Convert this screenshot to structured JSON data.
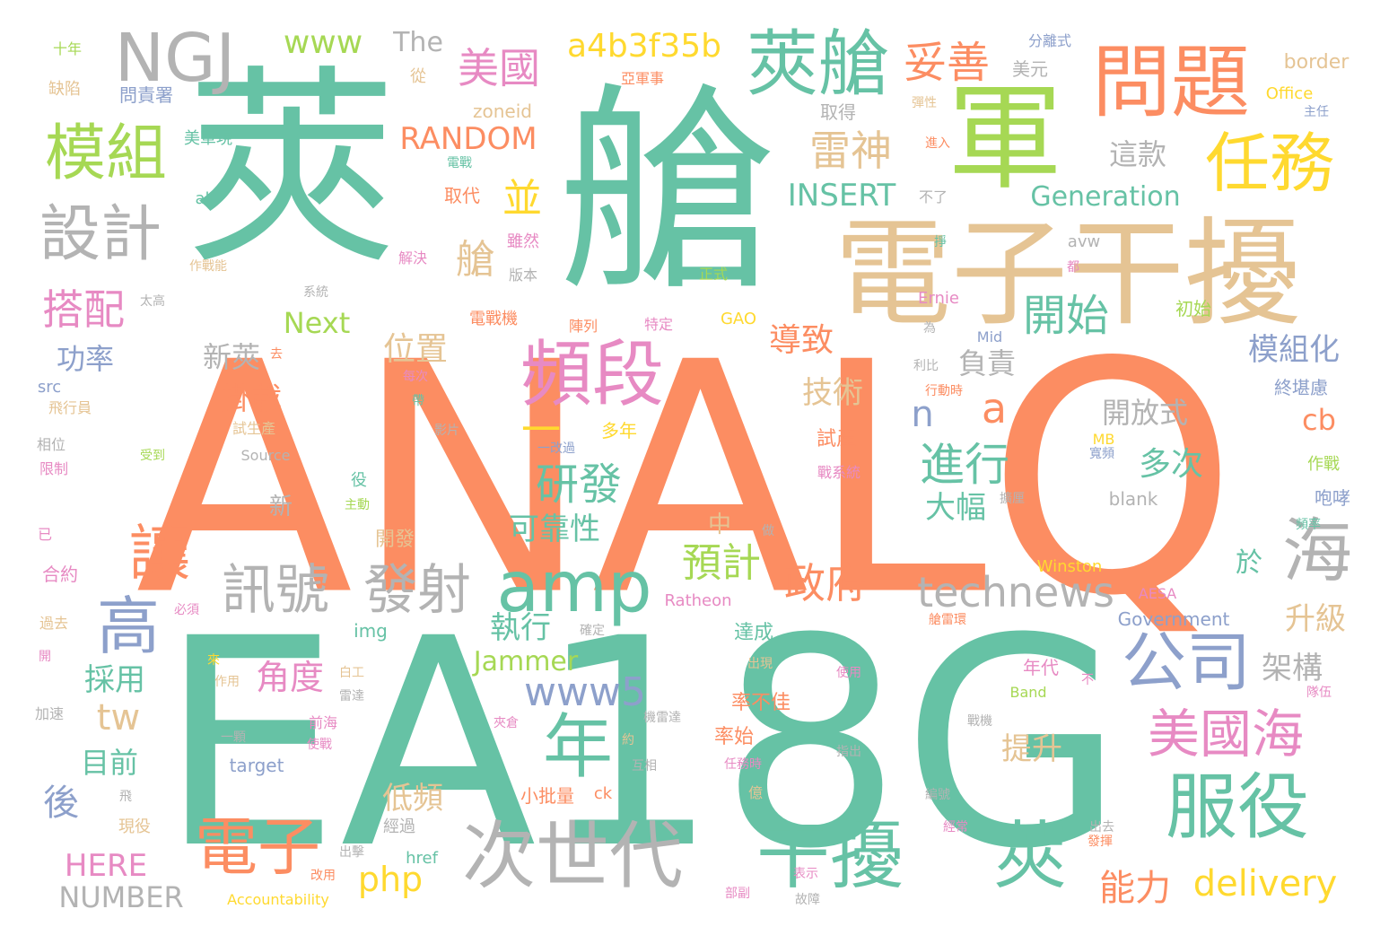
{
  "palette": [
    "#66c2a5",
    "#fc8d62",
    "#8da0cb",
    "#e78ac3",
    "#a6d854",
    "#ffd92f",
    "#e5c494",
    "#b3b3b3"
  ],
  "words": [
    {
      "text": "ANALQ",
      "color": "#fc8d62"
    },
    {
      "text": "EA18G",
      "color": "#66c2a5"
    },
    {
      "text": "莢",
      "color": "#66c2a5"
    },
    {
      "text": "艙",
      "color": "#66c2a5"
    },
    {
      "text": "電子干擾",
      "color": "#e5c494"
    },
    {
      "text": "軍",
      "color": "#a6d854"
    },
    {
      "text": "莢艙",
      "color": "#66c2a5"
    },
    {
      "text": "問題",
      "color": "#fc8d62"
    },
    {
      "text": "任務",
      "color": "#ffd92f"
    },
    {
      "text": "NGJ",
      "color": "#b3b3b3"
    },
    {
      "text": "模組",
      "color": "#a6d854"
    },
    {
      "text": "設計",
      "color": "#b3b3b3"
    },
    {
      "text": "頻段",
      "color": "#e78ac3"
    },
    {
      "text": "amp",
      "color": "#66c2a5"
    },
    {
      "text": "訊號",
      "color": "#b3b3b3"
    },
    {
      "text": "發射",
      "color": "#b3b3b3"
    },
    {
      "text": "高",
      "color": "#8da0cb"
    },
    {
      "text": "讓",
      "color": "#fc8d62"
    },
    {
      "text": "年",
      "color": "#66c2a5"
    },
    {
      "text": "公司",
      "color": "#8da0cb"
    },
    {
      "text": "海",
      "color": "#b3b3b3"
    },
    {
      "text": "服役",
      "color": "#66c2a5"
    },
    {
      "text": "美國海",
      "color": "#e78ac3"
    },
    {
      "text": "次世代",
      "color": "#b3b3b3"
    },
    {
      "text": "干擾",
      "color": "#66c2a5"
    },
    {
      "text": "莢",
      "color": "#66c2a5"
    },
    {
      "text": "電子",
      "color": "#fc8d62"
    },
    {
      "text": "technews",
      "color": "#b3b3b3"
    },
    {
      "text": "www5",
      "color": "#8da0cb"
    },
    {
      "text": "研發",
      "color": "#66c2a5"
    },
    {
      "text": "進行",
      "color": "#66c2a5"
    },
    {
      "text": "開始",
      "color": "#66c2a5"
    },
    {
      "text": "雷神",
      "color": "#e5c494"
    },
    {
      "text": "妥善",
      "color": "#fc8d62"
    },
    {
      "text": "美國",
      "color": "#e78ac3"
    },
    {
      "text": "a4b3f35b",
      "color": "#ffd92f"
    },
    {
      "text": "www",
      "color": "#a6d854"
    },
    {
      "text": "The",
      "color": "#b3b3b3"
    },
    {
      "text": "RANDOM",
      "color": "#fc8d62"
    },
    {
      "text": "INSERT",
      "color": "#66c2a5"
    },
    {
      "text": "Generation",
      "color": "#66c2a5"
    },
    {
      "text": "並",
      "color": "#ffd92f"
    },
    {
      "text": "艙",
      "color": "#e5c494"
    },
    {
      "text": "搭配",
      "color": "#e78ac3"
    },
    {
      "text": "Next",
      "color": "#a6d854"
    },
    {
      "text": "功率",
      "color": "#8da0cb"
    },
    {
      "text": "新莢",
      "color": "#b3b3b3"
    },
    {
      "text": "位置",
      "color": "#e5c494"
    },
    {
      "text": "導致",
      "color": "#fc8d62"
    },
    {
      "text": "負責",
      "color": "#b3b3b3"
    },
    {
      "text": "模組化",
      "color": "#8da0cb"
    },
    {
      "text": "技術",
      "color": "#e5c494"
    },
    {
      "text": "開放式",
      "color": "#b3b3b3"
    },
    {
      "text": "掛載",
      "color": "#fc8d62"
    },
    {
      "text": "一",
      "color": "#ffd92f"
    },
    {
      "text": "n",
      "color": "#8da0cb"
    },
    {
      "text": "a",
      "color": "#fc8d62"
    },
    {
      "text": "cb",
      "color": "#fc8d62"
    },
    {
      "text": "多次",
      "color": "#66c2a5"
    },
    {
      "text": "大幅",
      "color": "#66c2a5"
    },
    {
      "text": "可靠性",
      "color": "#66c2a5"
    },
    {
      "text": "預計",
      "color": "#a6d854"
    },
    {
      "text": "政府",
      "color": "#fc8d62"
    },
    {
      "text": "於",
      "color": "#66c2a5"
    },
    {
      "text": "升級",
      "color": "#e5c494"
    },
    {
      "text": "架構",
      "color": "#b3b3b3"
    },
    {
      "text": "執行",
      "color": "#66c2a5"
    },
    {
      "text": "角度",
      "color": "#e78ac3"
    },
    {
      "text": "採用",
      "color": "#66c2a5"
    },
    {
      "text": "tw",
      "color": "#e5c494"
    },
    {
      "text": "目前",
      "color": "#66c2a5"
    },
    {
      "text": "後",
      "color": "#8da0cb"
    },
    {
      "text": "低頻",
      "color": "#e5c494"
    },
    {
      "text": "Jammer",
      "color": "#a6d854"
    },
    {
      "text": "提升",
      "color": "#e5c494"
    },
    {
      "text": "delivery",
      "color": "#ffd92f"
    },
    {
      "text": "能力",
      "color": "#fc8d62"
    },
    {
      "text": "php",
      "color": "#ffd92f"
    },
    {
      "text": "HERE",
      "color": "#e78ac3"
    },
    {
      "text": "NUMBER",
      "color": "#b3b3b3"
    },
    {
      "text": "這款",
      "color": "#b3b3b3"
    },
    {
      "text": "美元",
      "color": "#b3b3b3"
    },
    {
      "text": "取得",
      "color": "#b3b3b3"
    },
    {
      "text": "zoneid",
      "color": "#e5c494"
    },
    {
      "text": "border",
      "color": "#e5c494"
    },
    {
      "text": "Office",
      "color": "#ffd92f"
    },
    {
      "text": "十年",
      "color": "#a6d854"
    },
    {
      "text": "缺陷",
      "color": "#e5c494"
    },
    {
      "text": "問責署",
      "color": "#8da0cb"
    },
    {
      "text": "美軍現",
      "color": "#66c2a5"
    },
    {
      "text": "從",
      "color": "#e5c494"
    },
    {
      "text": "亞軍事",
      "color": "#fc8d62"
    },
    {
      "text": "分離式",
      "color": "#8da0cb"
    },
    {
      "text": "彈性",
      "color": "#e5c494"
    },
    {
      "text": "主任",
      "color": "#8da0cb"
    },
    {
      "text": "取代",
      "color": "#fc8d62"
    },
    {
      "text": "雖然",
      "color": "#e78ac3"
    },
    {
      "text": "版本",
      "color": "#b3b3b3"
    },
    {
      "text": "正式",
      "color": "#a6d854"
    },
    {
      "text": "電戰",
      "color": "#66c2a5"
    },
    {
      "text": "進入",
      "color": "#fc8d62"
    },
    {
      "text": "不了",
      "color": "#b3b3b3"
    },
    {
      "text": "avw",
      "color": "#b3b3b3"
    },
    {
      "text": "都",
      "color": "#e78ac3"
    },
    {
      "text": "掙",
      "color": "#66c2a5"
    },
    {
      "text": "alt",
      "color": "#66c2a5"
    },
    {
      "text": "作戰能",
      "color": "#e5c494"
    },
    {
      "text": "解決",
      "color": "#e78ac3"
    },
    {
      "text": "太高",
      "color": "#b3b3b3"
    },
    {
      "text": "系統",
      "color": "#b3b3b3"
    },
    {
      "text": "電戰機",
      "color": "#fc8d62"
    },
    {
      "text": "陣列",
      "color": "#fc8d62"
    },
    {
      "text": "特定",
      "color": "#e78ac3"
    },
    {
      "text": "GAO",
      "color": "#ffd92f"
    },
    {
      "text": "Ernie",
      "color": "#e78ac3"
    },
    {
      "text": "初始",
      "color": "#a6d854"
    },
    {
      "text": "為",
      "color": "#b3b3b3"
    },
    {
      "text": "Mid",
      "color": "#8da0cb"
    },
    {
      "text": "去",
      "color": "#fc8d62"
    },
    {
      "text": "每次",
      "color": "#e78ac3"
    },
    {
      "text": "利比",
      "color": "#b3b3b3"
    },
    {
      "text": "行動時",
      "color": "#fc8d62"
    },
    {
      "text": "終堪慮",
      "color": "#8da0cb"
    },
    {
      "text": "src",
      "color": "#8da0cb"
    },
    {
      "text": "飛行員",
      "color": "#e5c494"
    },
    {
      "text": "帶",
      "color": "#66c2a5"
    },
    {
      "text": "試生產",
      "color": "#e5c494"
    },
    {
      "text": "影片",
      "color": "#b3b3b3"
    },
    {
      "text": "多年",
      "color": "#ffd92f"
    },
    {
      "text": "試產",
      "color": "#fc8d62"
    },
    {
      "text": "MB",
      "color": "#ffd92f"
    },
    {
      "text": "寬頻",
      "color": "#8da0cb"
    },
    {
      "text": "相位",
      "color": "#b3b3b3"
    },
    {
      "text": "限制",
      "color": "#e78ac3"
    },
    {
      "text": "受到",
      "color": "#a6d854"
    },
    {
      "text": "Source",
      "color": "#b3b3b3"
    },
    {
      "text": "一改過",
      "color": "#8da0cb"
    },
    {
      "text": "戰系統",
      "color": "#e78ac3"
    },
    {
      "text": "作戰",
      "color": "#a6d854"
    },
    {
      "text": "咆哮",
      "color": "#8da0cb"
    },
    {
      "text": "役",
      "color": "#66c2a5"
    },
    {
      "text": "主動",
      "color": "#a6d854"
    },
    {
      "text": "blank",
      "color": "#b3b3b3"
    },
    {
      "text": "擴厘",
      "color": "#b3b3b3"
    },
    {
      "text": "頻率",
      "color": "#66c2a5"
    },
    {
      "text": "新",
      "color": "#b3b3b3"
    },
    {
      "text": "中",
      "color": "#e5c494"
    },
    {
      "text": "開發",
      "color": "#e5c494"
    },
    {
      "text": "已",
      "color": "#e78ac3"
    },
    {
      "text": "合約",
      "color": "#e78ac3"
    },
    {
      "text": "做",
      "color": "#b3b3b3"
    },
    {
      "text": "Winston",
      "color": "#ffd92f"
    },
    {
      "text": "必須",
      "color": "#e78ac3"
    },
    {
      "text": "Ratheon",
      "color": "#e78ac3"
    },
    {
      "text": "AESA",
      "color": "#e78ac3"
    },
    {
      "text": "過去",
      "color": "#e5c494"
    },
    {
      "text": "img",
      "color": "#66c2a5"
    },
    {
      "text": "確定",
      "color": "#b3b3b3"
    },
    {
      "text": "達成",
      "color": "#66c2a5"
    },
    {
      "text": "艙雷環",
      "color": "#fc8d62"
    },
    {
      "text": "Government",
      "color": "#8da0cb"
    },
    {
      "text": "開",
      "color": "#e78ac3"
    },
    {
      "text": "來",
      "color": "#ffd92f"
    },
    {
      "text": "白工",
      "color": "#e5c494"
    },
    {
      "text": "作用",
      "color": "#e5c494"
    },
    {
      "text": "出現",
      "color": "#e5c494"
    },
    {
      "text": "使用",
      "color": "#e78ac3"
    },
    {
      "text": "年代",
      "color": "#e78ac3"
    },
    {
      "text": "不",
      "color": "#e78ac3"
    },
    {
      "text": "隊伍",
      "color": "#e78ac3"
    },
    {
      "text": "雷達",
      "color": "#b3b3b3"
    },
    {
      "text": "Band",
      "color": "#a6d854"
    },
    {
      "text": "加速",
      "color": "#b3b3b3"
    },
    {
      "text": "前海",
      "color": "#e78ac3"
    },
    {
      "text": "率不佳",
      "color": "#fc8d62"
    },
    {
      "text": "夾倉",
      "color": "#e78ac3"
    },
    {
      "text": "機雷達",
      "color": "#b3b3b3"
    },
    {
      "text": "戰機",
      "color": "#b3b3b3"
    },
    {
      "text": "一顆",
      "color": "#b3b3b3"
    },
    {
      "text": "使戰",
      "color": "#e78ac3"
    },
    {
      "text": "率始",
      "color": "#fc8d62"
    },
    {
      "text": "約",
      "color": "#e5c494"
    },
    {
      "text": "指出",
      "color": "#b3b3b3"
    },
    {
      "text": "target",
      "color": "#8da0cb"
    },
    {
      "text": "任務時",
      "color": "#e78ac3"
    },
    {
      "text": "互相",
      "color": "#b3b3b3"
    },
    {
      "text": "飛",
      "color": "#b3b3b3"
    },
    {
      "text": "小批量",
      "color": "#fc8d62"
    },
    {
      "text": "ck",
      "color": "#fc8d62"
    },
    {
      "text": "億",
      "color": "#e5c494"
    },
    {
      "text": "經常",
      "color": "#e78ac3"
    },
    {
      "text": "編號",
      "color": "#b3b3b3"
    },
    {
      "text": "現役",
      "color": "#e5c494"
    },
    {
      "text": "經過",
      "color": "#b3b3b3"
    },
    {
      "text": "出去",
      "color": "#b3b3b3"
    },
    {
      "text": "發揮",
      "color": "#fc8d62"
    },
    {
      "text": "出擊",
      "color": "#b3b3b3"
    },
    {
      "text": "href",
      "color": "#66c2a5"
    },
    {
      "text": "改用",
      "color": "#fc8d62"
    },
    {
      "text": "表示",
      "color": "#e78ac3"
    },
    {
      "text": "Accountability",
      "color": "#ffd92f"
    },
    {
      "text": "部副",
      "color": "#e78ac3"
    },
    {
      "text": "故障",
      "color": "#b3b3b3"
    }
  ]
}
